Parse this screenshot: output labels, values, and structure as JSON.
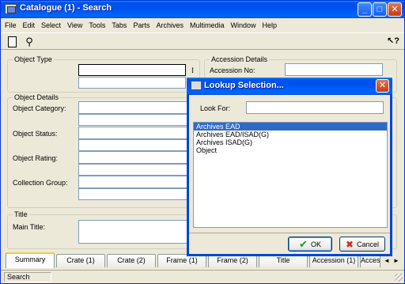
{
  "window": {
    "title": "Catalogue (1) - Search"
  },
  "titlebar_buttons": {
    "minimize": "_",
    "maximize": "□",
    "close": "✕"
  },
  "menu": [
    "File",
    "Edit",
    "Select",
    "View",
    "Tools",
    "Tabs",
    "Parts",
    "Archives",
    "Multimedia",
    "Window",
    "Help"
  ],
  "toolbar": {
    "new_icon": "document-icon",
    "find_icon": "binoculars-icon",
    "find_glyph": "⚲",
    "help_icon": "whats-this-help-icon",
    "help_glyph": "↖?"
  },
  "object_type": {
    "label": "Object Type",
    "lookup_glyph": "⁞"
  },
  "accession": {
    "label": "Accession Details",
    "accession_no_label": "Accession No:"
  },
  "object_details": {
    "label": "Object Details",
    "fields": [
      "Object Category:",
      "Object Status:",
      "Object Rating:",
      "Collection Group:"
    ]
  },
  "title_group": {
    "label": "Title",
    "main_title_label": "Main Title:"
  },
  "tabs": [
    "Summary",
    "Crate (1)",
    "Crate (2)",
    "Frame (1)",
    "Frame (2)",
    "Title",
    "Accession (1)",
    "Acces"
  ],
  "tab_scroll": {
    "left": "◄",
    "right": "►"
  },
  "status": {
    "text": "Search"
  },
  "dialog": {
    "title": "Lookup Selection...",
    "close_glyph": "✕",
    "look_for_label": "Look For:",
    "look_for_value": "",
    "items": [
      "Archives EAD",
      "Archives EAD/ISAD(G)",
      "Archives ISAD(G)",
      "Object"
    ],
    "selected_index": 0,
    "ok_label": "OK",
    "ok_glyph": "✔",
    "cancel_label": "Cancel",
    "cancel_glyph": "✖"
  },
  "colors": {
    "titlebar": "#0053ee",
    "selection": "#316ac5",
    "window_bg": "#ece9d8"
  }
}
